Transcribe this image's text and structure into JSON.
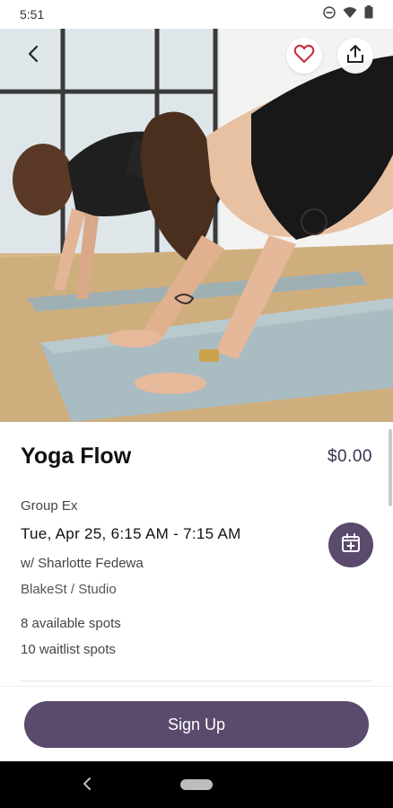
{
  "status_bar": {
    "time": "5:51",
    "icons": [
      "do-not-disturb-icon",
      "wifi-icon",
      "battery-icon"
    ]
  },
  "hero": {
    "image": "yoga-class-photo",
    "buttons": {
      "back": "back-arrow-icon",
      "favorite": "heart-icon",
      "share": "share-icon"
    }
  },
  "class": {
    "title": "Yoga Flow",
    "price": "$0.00",
    "category": "Group Ex",
    "datetime": "Tue, Apr 25, 6:15 AM - 7:15 AM",
    "instructor": "w/ Sharlotte Fedewa",
    "location": "BlakeSt / Studio",
    "available_spots": "8 available spots",
    "waitlist_spots": "10 waitlist spots",
    "calendar_action_icon": "add-to-calendar-icon"
  },
  "actions": {
    "signup_label": "Sign Up"
  },
  "colors": {
    "accent": "#5a4a6b",
    "price_text": "#3d2f52",
    "favorite_heart": "#c8283c"
  }
}
